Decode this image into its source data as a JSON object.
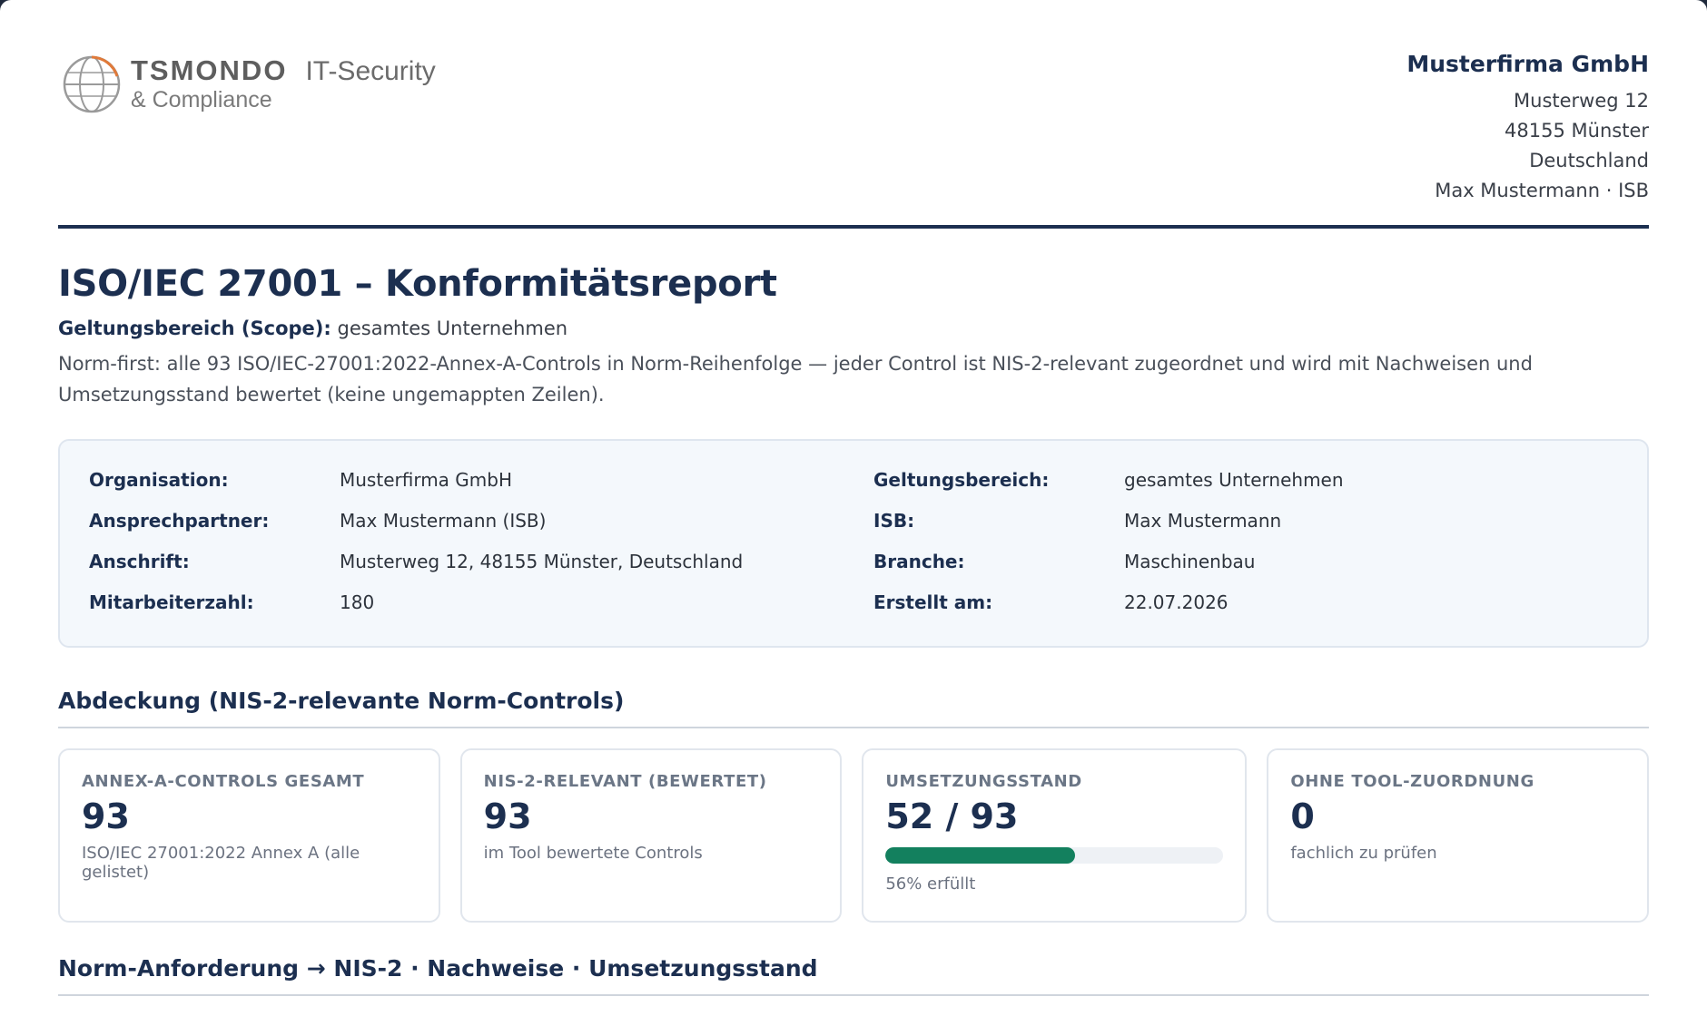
{
  "logo": {
    "brand": "TSMONDO",
    "line1": "IT-Security",
    "line2": "& Compliance"
  },
  "company": {
    "name": "Musterfirma GmbH",
    "street": "Musterweg 12",
    "city": "48155 Münster",
    "country": "Deutschland",
    "contact": "Max Mustermann · ISB"
  },
  "report": {
    "title": "ISO/IEC 27001 – Konformitätsreport",
    "scope_label": "Geltungsbereich (Scope):",
    "scope_value": "gesamtes Unternehmen",
    "description": "Norm-first: alle 93 ISO/IEC-27001:2022-Annex-A-Controls in Norm-Reihenfolge — jeder Control ist NIS-2-relevant zugeordnet und wird mit Nachweisen und Umsetzungsstand bewertet (keine ungemappten Zeilen)."
  },
  "info": {
    "rows": [
      {
        "k1": "Organisation:",
        "v1": "Musterfirma GmbH",
        "k2": "Geltungsbereich:",
        "v2": "gesamtes Unternehmen"
      },
      {
        "k1": "Ansprechpartner:",
        "v1": "Max Mustermann (ISB)",
        "k2": "ISB:",
        "v2": "Max Mustermann"
      },
      {
        "k1": "Anschrift:",
        "v1": "Musterweg 12, 48155 Münster, Deutschland",
        "k2": "Branche:",
        "v2": "Maschinenbau"
      },
      {
        "k1": "Mitarbeiterzahl:",
        "v1": "180",
        "k2": "Erstellt am:",
        "v2": "22.07.2026"
      }
    ]
  },
  "coverage": {
    "heading": "Abdeckung (NIS-2-relevante Norm-Controls)",
    "cards": [
      {
        "label": "ANNEX-A-CONTROLS GESAMT",
        "value": "93",
        "sub": "ISO/IEC 27001:2022 Annex A (alle gelistet)"
      },
      {
        "label": "NIS-2-RELEVANT (BEWERTET)",
        "value": "93",
        "sub": "im Tool bewertete Controls"
      },
      {
        "label": "UMSETZUNGSSTAND",
        "value": "52 / 93",
        "progress_fraction": 0.56,
        "sub": "56% erfüllt"
      },
      {
        "label": "OHNE TOOL-ZUORDNUNG",
        "value": "0",
        "sub": "fachlich zu prüfen"
      }
    ]
  },
  "mapping": {
    "heading": "Norm-Anforderung → NIS-2 · Nachweise · Umsetzungsstand"
  },
  "colors": {
    "primary": "#1c2f50",
    "progress": "#13805e",
    "logo_accent": "#e07a3a"
  }
}
